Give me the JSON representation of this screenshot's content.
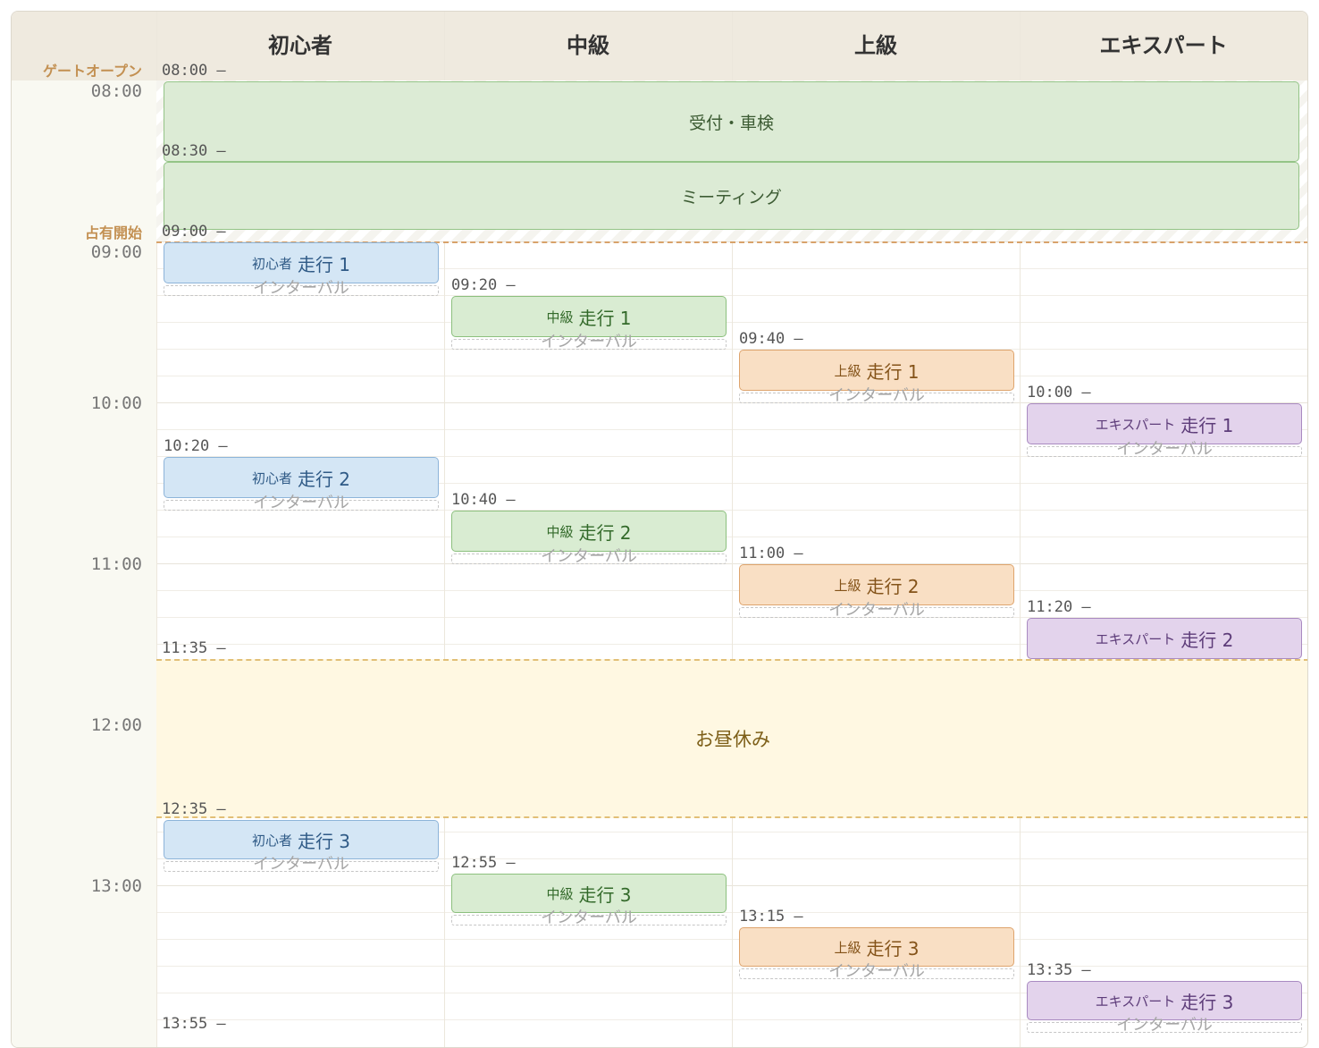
{
  "columns": [
    {
      "name": "初心者"
    },
    {
      "name": "中級"
    },
    {
      "name": "上級"
    },
    {
      "name": "エキスパート"
    }
  ],
  "markers": {
    "gate_open": "ゲートオープン",
    "occupation_start": "占有開始"
  },
  "hour_labels": [
    "08:00",
    "09:00",
    "10:00",
    "11:00",
    "12:00",
    "13:00"
  ],
  "common_events": [
    {
      "label": "受付・車検",
      "start": "08:00 –"
    },
    {
      "label": "ミーティング",
      "start": "08:30 –"
    }
  ],
  "occupation_start_time": "09:00 –",
  "lunch": {
    "label": "お昼休み",
    "start": "11:35 –",
    "end": "12:35 –"
  },
  "interval_label": "インターバル",
  "runs": {
    "beginner": [
      {
        "class": "初心者",
        "run": "走行 1",
        "start": ""
      },
      {
        "class": "初心者",
        "run": "走行 2",
        "start": "10:20 –"
      },
      {
        "class": "初心者",
        "run": "走行 3",
        "start": ""
      }
    ],
    "intermediate": [
      {
        "class": "中級",
        "run": "走行 1",
        "start": "09:20 –"
      },
      {
        "class": "中級",
        "run": "走行 2",
        "start": "10:40 –"
      },
      {
        "class": "中級",
        "run": "走行 3",
        "start": "12:55 –"
      }
    ],
    "advanced": [
      {
        "class": "上級",
        "run": "走行 1",
        "start": "09:40 –"
      },
      {
        "class": "上級",
        "run": "走行 2",
        "start": "11:00 –"
      },
      {
        "class": "上級",
        "run": "走行 3",
        "start": "13:15 –"
      }
    ],
    "expert": [
      {
        "class": "エキスパート",
        "run": "走行 1",
        "start": "10:00 –"
      },
      {
        "class": "エキスパート",
        "run": "走行 2",
        "start": "11:20 –"
      },
      {
        "class": "エキスパート",
        "run": "走行 3",
        "start": "13:35 –"
      }
    ]
  },
  "trailing_time": "13:55 –",
  "colors": {
    "beginner": "#d4e6f5",
    "intermediate": "#d9ecd2",
    "advanced": "#f9dfc4",
    "expert": "#e3d3ec",
    "common": "#dcebd5",
    "lunch": "#fff8e2",
    "marker": "#c39052"
  }
}
